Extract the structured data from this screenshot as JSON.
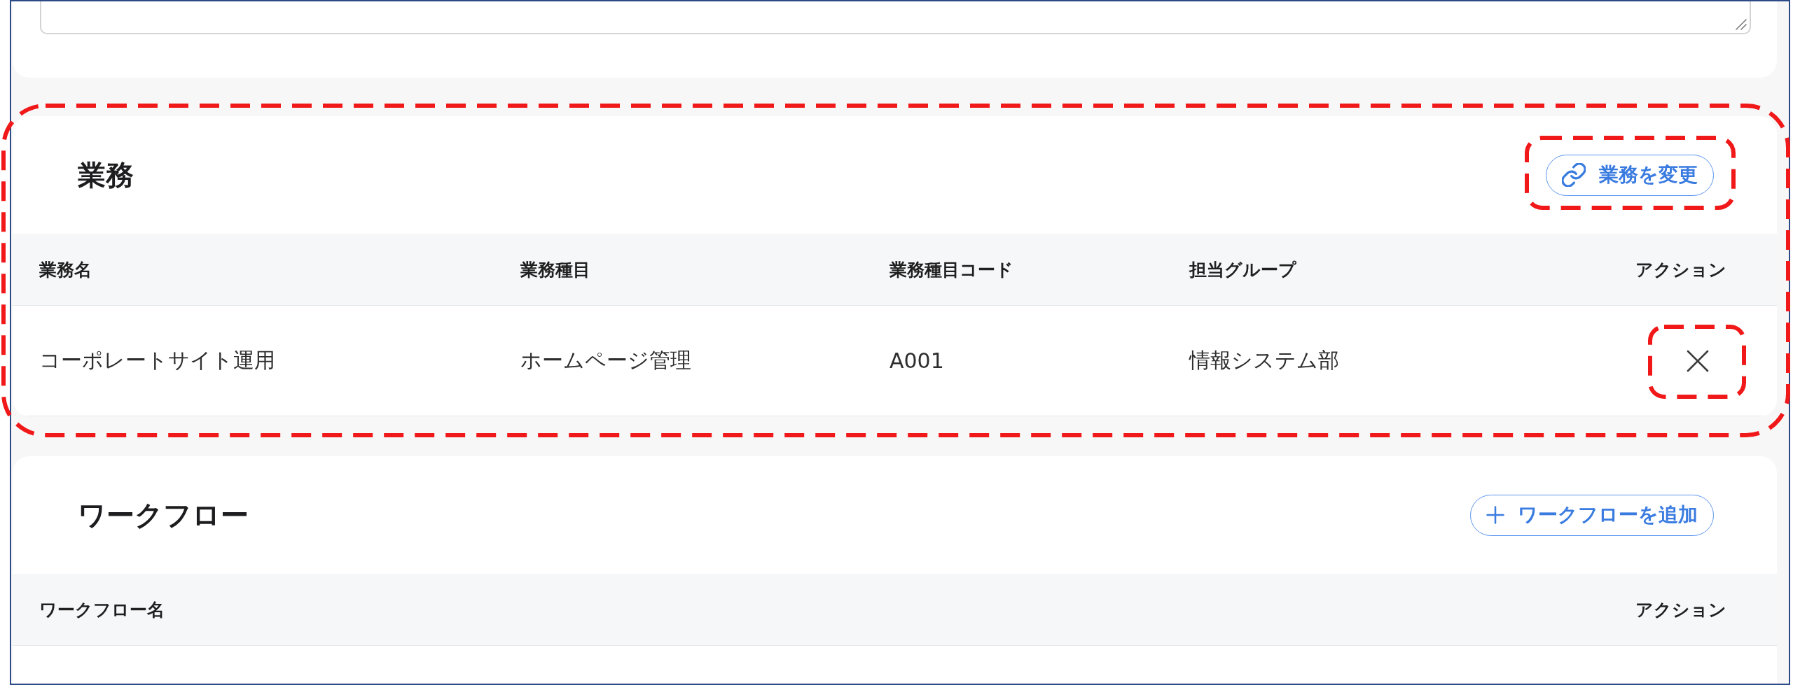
{
  "top_card": {
    "text_area": {
      "resizable": true
    }
  },
  "sections": [
    {
      "kind": "business",
      "title": "業務",
      "highlighted": true,
      "action": {
        "label": "業務を変更",
        "highlighted": true
      },
      "table": {
        "columns": [
          "業務名",
          "業務種目",
          "業務種目コード",
          "担当グループ",
          "アクション"
        ],
        "rows": [
          {
            "cells": [
              "コーポレートサイト運用",
              "ホームページ管理",
              "A001",
              "情報システム部"
            ],
            "remove_button": {
              "highlighted": true
            }
          }
        ]
      }
    },
    {
      "kind": "workflow",
      "title": "ワークフロー",
      "highlighted": false,
      "action": {
        "label": "ワークフローを追加",
        "highlighted": false
      },
      "table": {
        "columns": [
          "ワークフロー名",
          "アクション"
        ]
      }
    }
  ]
}
